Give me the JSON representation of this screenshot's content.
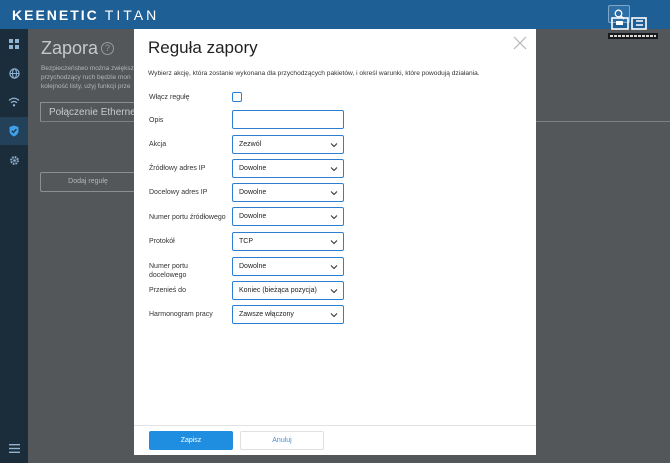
{
  "topbar": {
    "brand": "KEENETIC",
    "model": "TITAN",
    "watermark": "PurePC"
  },
  "sidebar": {
    "items": [
      {
        "icon": "dashboard-icon",
        "active": false
      },
      {
        "icon": "globe-icon",
        "active": false
      },
      {
        "icon": "wifi-icon",
        "active": false
      },
      {
        "icon": "shield-icon",
        "active": true
      },
      {
        "icon": "gear-icon",
        "active": false
      }
    ],
    "menu_icon": "hamburger-menu-icon"
  },
  "background_page": {
    "title": "Zapora",
    "help": "?",
    "description": "Bezpieczeństwo można zwiększ\nprzychodzący ruch będzie mon\nkolejność listy, użyj funkcji prze",
    "tab": "Połączenie Ethernet",
    "add_rule": "Dodaj regułę"
  },
  "modal": {
    "title": "Reguła zapory",
    "description": "Wybierz akcję, która zostanie wykonana dla przychodzących pakietów, i określ warunki, które powodują działania.",
    "fields": {
      "enable": {
        "label": "Włącz regułę",
        "checked": false
      },
      "description": {
        "label": "Opis",
        "value": "",
        "placeholder": ""
      },
      "action": {
        "label": "Akcja",
        "value": "Zezwól"
      },
      "source_ip": {
        "label": "Źródłowy adres IP",
        "value": "Dowolne"
      },
      "dest_ip": {
        "label": "Docelowy adres IP",
        "value": "Dowolne"
      },
      "source_port": {
        "label": "Numer portu źródłowego",
        "value": "Dowolne"
      },
      "protocol": {
        "label": "Protokół",
        "value": "TCP"
      },
      "dest_port": {
        "label": "Numer portu docelowego",
        "value": "Dowolne"
      },
      "move_to": {
        "label": "Przenieś do",
        "value": "Koniec (bieżąca pozycja)"
      },
      "schedule": {
        "label": "Harmonogram pracy",
        "value": "Zawsze włączony"
      }
    },
    "buttons": {
      "save": "Zapisz",
      "cancel": "Anuluj"
    }
  },
  "colors": {
    "topbar": "#1e5f96",
    "sidebar": "#1b2c3a",
    "primary": "#1f8ee0",
    "field_border": "#2f7fd1"
  }
}
